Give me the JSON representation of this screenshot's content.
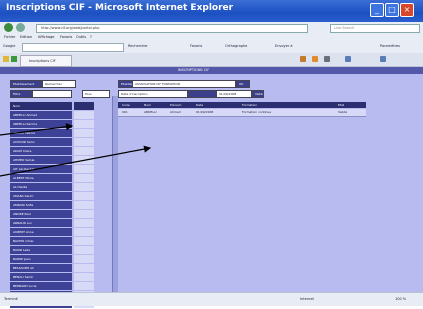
{
  "window": {
    "title": "Inscriptions CIF - Microsoft Internet Explorer",
    "controls": [
      "_",
      "□",
      "×"
    ]
  },
  "address_bar": {
    "url": "http://www.cif.org/web/portal.php",
    "search_placeholder": "Live Search"
  },
  "menu": [
    "Fichier",
    "Edition",
    "Affichage",
    "Favoris",
    "Outils",
    "?"
  ],
  "toolbar": {
    "google_box": "Google",
    "search_label": "Rechercher",
    "bookmarks_label": "Favoris",
    "orthographe_label": "Orthographe",
    "envoyer_label": "Envoyer à",
    "settings_label": "Paramètres"
  },
  "tab": {
    "label": "Inscriptions CIF"
  },
  "page": {
    "header_title": "INSCRIPTIONS CIF",
    "left_controls": [
      {
        "label": "Etablissement"
      },
      {
        "label": "Rechercher"
      },
      {
        "label": "Filtre"
      },
      {
        "label": "Tous"
      }
    ],
    "list_header": "Nom",
    "list_items": [
      "ABDELLI Ahmed",
      "ABDELLI Karima",
      "ABDOU Fatima",
      "ACHOUR Sami",
      "ADAM Claire",
      "AHMED Samia",
      "AIT ALI Rachid",
      "ALBERT Marie",
      "ALI Nadia",
      "AMARA Karim",
      "AMRANI Sofia",
      "ANDRE Paul",
      "ARNAUD Luc",
      "AUBERT Anne",
      "BACHIR Omar",
      "BAKIR Leila",
      "BARRE Jean",
      "BELKACEM Ali",
      "BENALI Samir",
      "BERNARD Lucie",
      "BLANC Pierre",
      "BONNET Eric",
      "BRUN Sophie",
      "CAMUS Louis"
    ],
    "query_row1": {
      "label": "Etablissement",
      "value": "ASSOCIATION CIF FORMATION",
      "button": "OK"
    },
    "query_row2": {
      "label": "Date d'inscription",
      "value": "01/09/2008",
      "button2": "Valider"
    },
    "grid_headers": [
      "Code",
      "Nom",
      "Prénom",
      "Date",
      "Formation",
      "Etat"
    ],
    "grid_row": [
      "001",
      "ABDELLI",
      "Ahmed",
      "01/09/2008",
      "Formation continue",
      "Validé"
    ]
  },
  "status": {
    "left": "Terminé",
    "zone": "Internet",
    "zoom": "100 %"
  }
}
